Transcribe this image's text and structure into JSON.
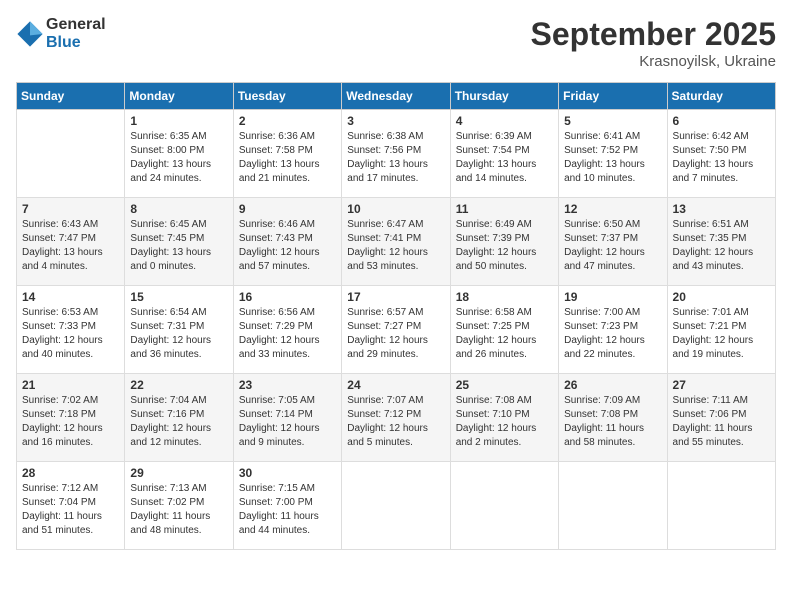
{
  "logo": {
    "general": "General",
    "blue": "Blue"
  },
  "title": "September 2025",
  "location": "Krasnoyilsk, Ukraine",
  "days_header": [
    "Sunday",
    "Monday",
    "Tuesday",
    "Wednesday",
    "Thursday",
    "Friday",
    "Saturday"
  ],
  "weeks": [
    [
      {
        "day": "",
        "info": ""
      },
      {
        "day": "1",
        "info": "Sunrise: 6:35 AM\nSunset: 8:00 PM\nDaylight: 13 hours\nand 24 minutes."
      },
      {
        "day": "2",
        "info": "Sunrise: 6:36 AM\nSunset: 7:58 PM\nDaylight: 13 hours\nand 21 minutes."
      },
      {
        "day": "3",
        "info": "Sunrise: 6:38 AM\nSunset: 7:56 PM\nDaylight: 13 hours\nand 17 minutes."
      },
      {
        "day": "4",
        "info": "Sunrise: 6:39 AM\nSunset: 7:54 PM\nDaylight: 13 hours\nand 14 minutes."
      },
      {
        "day": "5",
        "info": "Sunrise: 6:41 AM\nSunset: 7:52 PM\nDaylight: 13 hours\nand 10 minutes."
      },
      {
        "day": "6",
        "info": "Sunrise: 6:42 AM\nSunset: 7:50 PM\nDaylight: 13 hours\nand 7 minutes."
      }
    ],
    [
      {
        "day": "7",
        "info": "Sunrise: 6:43 AM\nSunset: 7:47 PM\nDaylight: 13 hours\nand 4 minutes."
      },
      {
        "day": "8",
        "info": "Sunrise: 6:45 AM\nSunset: 7:45 PM\nDaylight: 13 hours\nand 0 minutes."
      },
      {
        "day": "9",
        "info": "Sunrise: 6:46 AM\nSunset: 7:43 PM\nDaylight: 12 hours\nand 57 minutes."
      },
      {
        "day": "10",
        "info": "Sunrise: 6:47 AM\nSunset: 7:41 PM\nDaylight: 12 hours\nand 53 minutes."
      },
      {
        "day": "11",
        "info": "Sunrise: 6:49 AM\nSunset: 7:39 PM\nDaylight: 12 hours\nand 50 minutes."
      },
      {
        "day": "12",
        "info": "Sunrise: 6:50 AM\nSunset: 7:37 PM\nDaylight: 12 hours\nand 47 minutes."
      },
      {
        "day": "13",
        "info": "Sunrise: 6:51 AM\nSunset: 7:35 PM\nDaylight: 12 hours\nand 43 minutes."
      }
    ],
    [
      {
        "day": "14",
        "info": "Sunrise: 6:53 AM\nSunset: 7:33 PM\nDaylight: 12 hours\nand 40 minutes."
      },
      {
        "day": "15",
        "info": "Sunrise: 6:54 AM\nSunset: 7:31 PM\nDaylight: 12 hours\nand 36 minutes."
      },
      {
        "day": "16",
        "info": "Sunrise: 6:56 AM\nSunset: 7:29 PM\nDaylight: 12 hours\nand 33 minutes."
      },
      {
        "day": "17",
        "info": "Sunrise: 6:57 AM\nSunset: 7:27 PM\nDaylight: 12 hours\nand 29 minutes."
      },
      {
        "day": "18",
        "info": "Sunrise: 6:58 AM\nSunset: 7:25 PM\nDaylight: 12 hours\nand 26 minutes."
      },
      {
        "day": "19",
        "info": "Sunrise: 7:00 AM\nSunset: 7:23 PM\nDaylight: 12 hours\nand 22 minutes."
      },
      {
        "day": "20",
        "info": "Sunrise: 7:01 AM\nSunset: 7:21 PM\nDaylight: 12 hours\nand 19 minutes."
      }
    ],
    [
      {
        "day": "21",
        "info": "Sunrise: 7:02 AM\nSunset: 7:18 PM\nDaylight: 12 hours\nand 16 minutes."
      },
      {
        "day": "22",
        "info": "Sunrise: 7:04 AM\nSunset: 7:16 PM\nDaylight: 12 hours\nand 12 minutes."
      },
      {
        "day": "23",
        "info": "Sunrise: 7:05 AM\nSunset: 7:14 PM\nDaylight: 12 hours\nand 9 minutes."
      },
      {
        "day": "24",
        "info": "Sunrise: 7:07 AM\nSunset: 7:12 PM\nDaylight: 12 hours\nand 5 minutes."
      },
      {
        "day": "25",
        "info": "Sunrise: 7:08 AM\nSunset: 7:10 PM\nDaylight: 12 hours\nand 2 minutes."
      },
      {
        "day": "26",
        "info": "Sunrise: 7:09 AM\nSunset: 7:08 PM\nDaylight: 11 hours\nand 58 minutes."
      },
      {
        "day": "27",
        "info": "Sunrise: 7:11 AM\nSunset: 7:06 PM\nDaylight: 11 hours\nand 55 minutes."
      }
    ],
    [
      {
        "day": "28",
        "info": "Sunrise: 7:12 AM\nSunset: 7:04 PM\nDaylight: 11 hours\nand 51 minutes."
      },
      {
        "day": "29",
        "info": "Sunrise: 7:13 AM\nSunset: 7:02 PM\nDaylight: 11 hours\nand 48 minutes."
      },
      {
        "day": "30",
        "info": "Sunrise: 7:15 AM\nSunset: 7:00 PM\nDaylight: 11 hours\nand 44 minutes."
      },
      {
        "day": "",
        "info": ""
      },
      {
        "day": "",
        "info": ""
      },
      {
        "day": "",
        "info": ""
      },
      {
        "day": "",
        "info": ""
      }
    ]
  ]
}
